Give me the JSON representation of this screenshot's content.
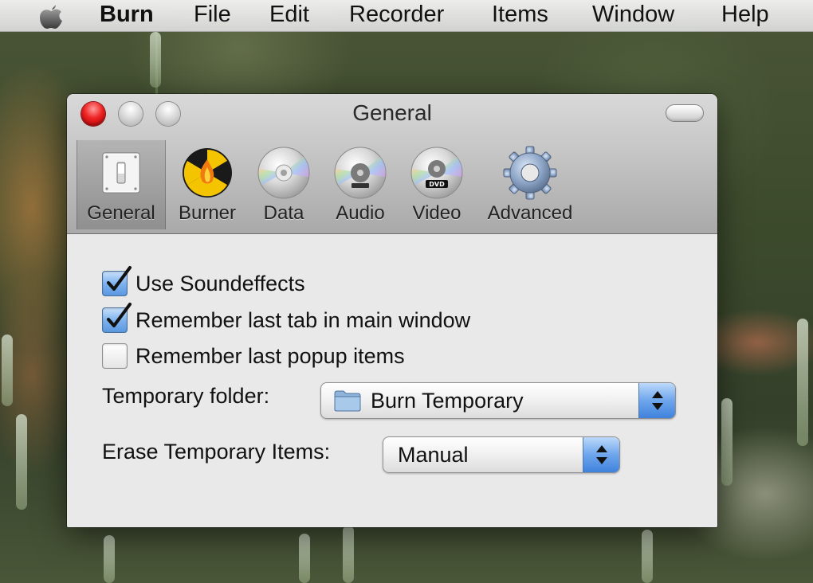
{
  "menubar": {
    "apple_icon": "apple-icon",
    "items": [
      "Burn",
      "File",
      "Edit",
      "Recorder",
      "Items",
      "Window",
      "Help"
    ]
  },
  "window": {
    "title": "General",
    "tabs": [
      {
        "label": "General",
        "icon": "light-switch-icon",
        "selected": true
      },
      {
        "label": "Burner",
        "icon": "burner-radioactive-icon",
        "selected": false
      },
      {
        "label": "Data",
        "icon": "data-disc-icon",
        "selected": false
      },
      {
        "label": "Audio",
        "icon": "audio-disc-icon",
        "selected": false
      },
      {
        "label": "Video",
        "icon": "dvd-disc-icon",
        "selected": false
      },
      {
        "label": "Advanced",
        "icon": "gear-icon",
        "selected": false
      }
    ],
    "checkboxes": [
      {
        "label": "Use Soundeffects",
        "checked": true
      },
      {
        "label": "Remember last tab in main window",
        "checked": true
      },
      {
        "label": "Remember last popup items",
        "checked": false
      }
    ],
    "temporary_folder": {
      "label": "Temporary folder:",
      "value": "Burn Temporary"
    },
    "erase_items": {
      "label": "Erase Temporary Items:",
      "value": "Manual"
    }
  },
  "colors": {
    "accent": "#5a97e0",
    "close": "#e22222"
  }
}
